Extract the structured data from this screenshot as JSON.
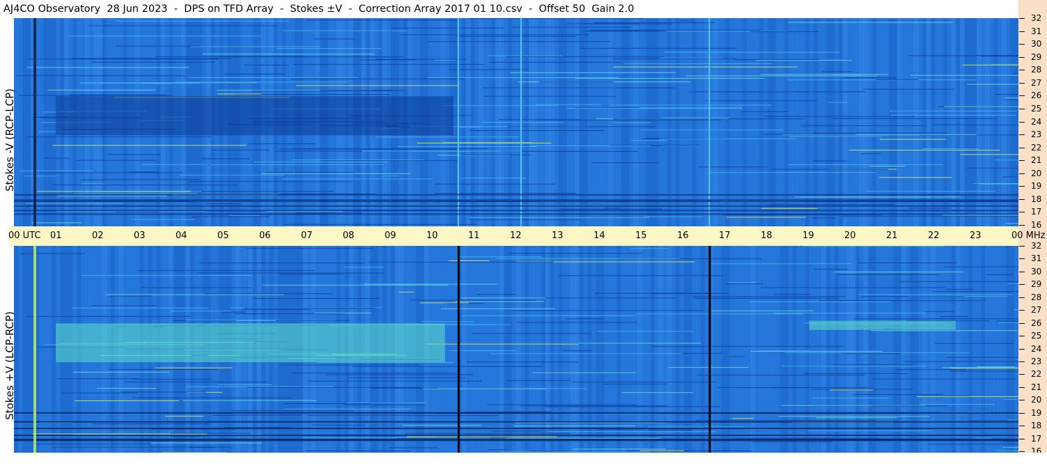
{
  "header": {
    "title": "AJ4CO Observatory  28 Jun 2023  -  DPS on TFD Array  -  Stokes ±V  -  Correction Array 2017 01 10.csv  -  Offset 50  Gain 2.0"
  },
  "panels": {
    "top_label": "Stokes -V (RCP-LCP)",
    "bottom_label": "Stokes +V (LCP-RCP)"
  },
  "time_axis": {
    "labels": [
      "00 UTC",
      "01",
      "02",
      "03",
      "04",
      "05",
      "06",
      "07",
      "08",
      "09",
      "10",
      "11",
      "12",
      "13",
      "14",
      "15",
      "16",
      "17",
      "18",
      "19",
      "20",
      "21",
      "22",
      "23",
      "00 MHz"
    ]
  },
  "freq_axis": {
    "labels": [
      "32",
      "31",
      "30",
      "29",
      "28",
      "27",
      "26",
      "25",
      "24",
      "23",
      "22",
      "21",
      "20",
      "19",
      "18",
      "17",
      "16"
    ]
  },
  "colors": {
    "background_blue": "#1f6fd6",
    "timebar": "#fcf7c4",
    "right_strip": "#fbe0c8"
  },
  "chart_data": [
    {
      "type": "heatmap",
      "title": "Stokes -V (RCP-LCP)",
      "x_axis": {
        "label": "UTC",
        "range": [
          0,
          24
        ]
      },
      "y_axis": {
        "label": "MHz",
        "range": [
          16,
          32
        ]
      },
      "features": [
        {
          "kind": "dark band",
          "time_start": 1.0,
          "time_end": 10.5,
          "freq_start": 23,
          "freq_end": 26
        },
        {
          "kind": "vertical line",
          "time": 10.6
        },
        {
          "kind": "vertical line",
          "time": 12.1
        },
        {
          "kind": "vertical line",
          "time": 16.6
        }
      ]
    },
    {
      "type": "heatmap",
      "title": "Stokes +V (LCP-RCP)",
      "x_axis": {
        "label": "UTC",
        "range": [
          0,
          24
        ]
      },
      "y_axis": {
        "label": "MHz",
        "range": [
          16,
          32
        ]
      },
      "features": [
        {
          "kind": "bright band",
          "time_start": 1.0,
          "time_end": 10.3,
          "freq_start": 23,
          "freq_end": 26
        },
        {
          "kind": "bright band",
          "time_start": 19.0,
          "time_end": 22.5,
          "freq_start": 25.5,
          "freq_end": 26.2
        },
        {
          "kind": "black vertical line",
          "time": 10.6
        },
        {
          "kind": "black vertical line",
          "time": 16.6
        }
      ]
    }
  ]
}
